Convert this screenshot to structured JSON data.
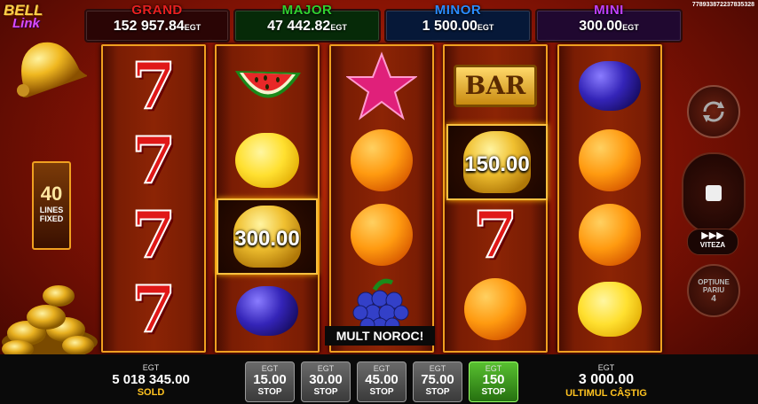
{
  "session_id": "778933872237835328",
  "logo": {
    "line1": "BELL",
    "line2": "Link"
  },
  "jackpots": [
    {
      "label": "GRAND",
      "amount": "152 957.84",
      "currency": "EGT",
      "label_color": "#e82020",
      "bg": "#2a0505"
    },
    {
      "label": "MAJOR",
      "amount": "47 442.82",
      "currency": "EGT",
      "label_color": "#30d030",
      "bg": "#062a08"
    },
    {
      "label": "MINOR",
      "amount": "1 500.00",
      "currency": "EGT",
      "label_color": "#2a8cff",
      "bg": "#061838"
    },
    {
      "label": "MINI",
      "amount": "300.00",
      "currency": "EGT",
      "label_color": "#c040ff",
      "bg": "#200830"
    }
  ],
  "lines": {
    "count": "40",
    "line1": "LINES",
    "line2": "FIXED"
  },
  "reels": [
    [
      "seven",
      "seven",
      "seven",
      "seven"
    ],
    [
      "watermelon",
      "lemon",
      "bell",
      "plum"
    ],
    [
      "star",
      "orange",
      "orange",
      "grapes"
    ],
    [
      "bar",
      "bell",
      "seven",
      "orange"
    ],
    [
      "plum",
      "orange",
      "orange",
      "lemon"
    ]
  ],
  "win_values": {
    "reel2": "300.00",
    "reel4": "150.00"
  },
  "bar_text": "BAR",
  "message": "MULT NOROC!",
  "controls": {
    "speed_label": "VITEZA",
    "bet_options_label1": "OPȚIUNE",
    "bet_options_label2": "PARIU",
    "bet_options_value": "4"
  },
  "balance": {
    "currency": "EGT",
    "value": "5 018 345.00",
    "caption": "SOLD"
  },
  "bets": [
    {
      "currency": "EGT",
      "value": "15.00",
      "caption": "STOP",
      "active": false
    },
    {
      "currency": "EGT",
      "value": "30.00",
      "caption": "STOP",
      "active": false
    },
    {
      "currency": "EGT",
      "value": "45.00",
      "caption": "STOP",
      "active": false
    },
    {
      "currency": "EGT",
      "value": "75.00",
      "caption": "STOP",
      "active": false
    },
    {
      "currency": "EGT",
      "value": "150",
      "caption": "STOP",
      "active": true
    }
  ],
  "last_win": {
    "currency": "EGT",
    "value": "3 000.00",
    "caption": "ULTIMUL CÂȘTIG"
  }
}
